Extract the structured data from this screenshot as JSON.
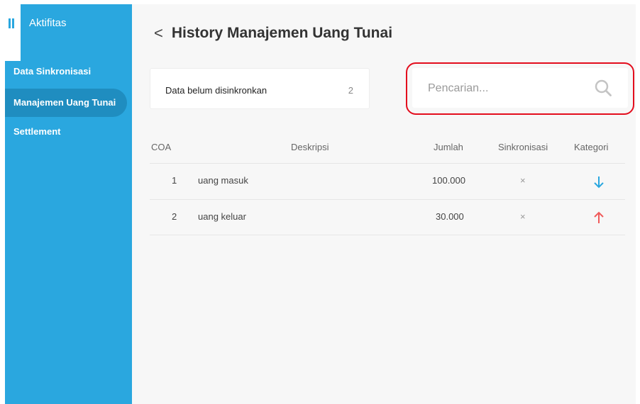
{
  "sidebar": {
    "app_title": "Aktifitas",
    "items": [
      {
        "label": "Data Sinkronisasi",
        "active": false
      },
      {
        "label": "Manajemen Uang Tunai",
        "active": true
      },
      {
        "label": "Settlement",
        "active": false
      }
    ],
    "accent_color": "#2aa7df"
  },
  "header": {
    "back_icon": "<",
    "title": "History Manajemen Uang Tunai"
  },
  "sync_card": {
    "label": "Data belum disinkronkan",
    "count": "2"
  },
  "search": {
    "placeholder": "Pencarian...",
    "value": "",
    "icon": "search-icon",
    "highlight_color": "#e30d1d"
  },
  "table": {
    "headers": {
      "coa": "COA",
      "deskripsi": "Deskripsi",
      "jumlah": "Jumlah",
      "sinkronisasi": "Sinkronisasi",
      "kategori": "Kategori"
    },
    "rows": [
      {
        "coa": "1",
        "deskripsi": "uang masuk",
        "jumlah": "100.000",
        "sinkronisasi": "×",
        "kategori": "arrow-down-icon",
        "kategori_color": "#2aa7df"
      },
      {
        "coa": "2",
        "deskripsi": "uang keluar",
        "jumlah": "30.000",
        "sinkronisasi": "×",
        "kategori": "arrow-up-icon",
        "kategori_color": "#f05a5a"
      }
    ]
  }
}
